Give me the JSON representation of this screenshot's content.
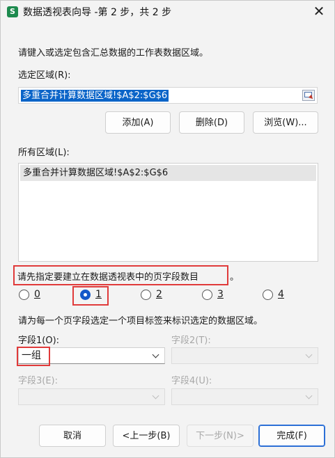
{
  "window": {
    "app_icon_letter": "S",
    "title": "数据透视表向导 -第 2 步，共 2 步",
    "close_glyph": "✕"
  },
  "instruction": "请键入或选定包含汇总数据的工作表数据区域。",
  "selected_range": {
    "label": "选定区域(R):",
    "value": "多重合并计算数据区域!$A$2:$G$6"
  },
  "range_buttons": {
    "add": "添加(A)",
    "delete": "删除(D)",
    "browse": "浏览(W)..."
  },
  "all_ranges": {
    "label": "所有区域(L):",
    "items": [
      "多重合并计算数据区域!$A$2:$G$6"
    ]
  },
  "page_fields": {
    "prompt": "请先指定要建立在数据透视表中的页字段数目",
    "trailing_punct": "。",
    "options": [
      "0",
      "1",
      "2",
      "3",
      "4"
    ],
    "selected": "1"
  },
  "field_instruction": "请为每一个页字段选定一个项目标签来标识选定的数据区域。",
  "fields": [
    {
      "label": "字段1(O):",
      "value": "一组",
      "enabled": true
    },
    {
      "label": "字段2(T):",
      "value": "",
      "enabled": false
    },
    {
      "label": "字段3(E):",
      "value": "",
      "enabled": false
    },
    {
      "label": "字段4(U):",
      "value": "",
      "enabled": false
    }
  ],
  "footer": {
    "cancel": "取消",
    "back": "<上一步(B)",
    "next": "下一步(N)>",
    "finish": "完成(F)"
  },
  "colors": {
    "highlight": "#e03a3a",
    "selection": "#0a64c8",
    "radio_checked": "#1559c9",
    "app_icon": "#1d8a4e"
  }
}
